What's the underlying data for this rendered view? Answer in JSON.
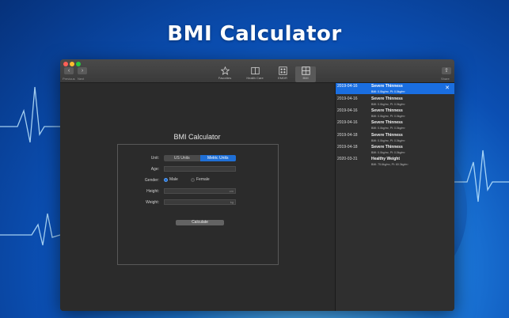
{
  "hero": {
    "title": "BMI Calculator"
  },
  "toolbar": {
    "previous_label": "Previous",
    "next_label": "Next",
    "items": [
      {
        "label": "Favorites",
        "icon": "star-icon"
      },
      {
        "label": "Health Care",
        "icon": "book-icon"
      },
      {
        "label": "EMDR",
        "icon": "grid-dots-icon"
      },
      {
        "label": "BMI",
        "icon": "calculator-icon",
        "active": true
      }
    ],
    "share_label": "Share"
  },
  "form": {
    "title": "BMI Calculator",
    "unit_label": "Unit:",
    "unit_options": [
      "US Units",
      "Metric Units"
    ],
    "unit_selected": "Metric Units",
    "age_label": "Age:",
    "age_value": "",
    "gender_label": "Gender:",
    "gender_options": [
      "Male",
      "Female"
    ],
    "gender_selected": "Male",
    "height_label": "Height:",
    "height_unit": "cm",
    "weight_label": "Weight:",
    "weight_unit": "kg",
    "calculate_label": "Calculate"
  },
  "history": [
    {
      "date": "2019-04-16",
      "category": "Severe Thinness",
      "detail": "BMI: 0.0kg/m²,  PI: 0.0kg/m³",
      "selected": true
    },
    {
      "date": "2019-04-16",
      "category": "Severe Thinness",
      "detail": "BMI: 0.0kg/m²,  PI: 0.0kg/m³"
    },
    {
      "date": "2019-04-16",
      "category": "Severe Thinness",
      "detail": "BMI: 0.0kg/m²,  PI: 0.0kg/m³"
    },
    {
      "date": "2019-04-16",
      "category": "Severe Thinness",
      "detail": "BMI: 0.0kg/m²,  PI: 0.0kg/m³"
    },
    {
      "date": "2019-04-18",
      "category": "Severe Thinness",
      "detail": "BMI: 0.0kg/m²,  PI: 0.0kg/m³"
    },
    {
      "date": "2019-04-18",
      "category": "Severe Thinness",
      "detail": "BMI: 0.0kg/m²,  PI: 0.0kg/m³"
    },
    {
      "date": "2020-03-31",
      "category": "Healthy Weight",
      "detail": "BMI: 75.6kg/m²,  PI: 60.3kg/m³"
    }
  ],
  "colors": {
    "accent": "#1f6fd6",
    "selection": "#1a6ee0",
    "window": "#2d2d2d"
  }
}
